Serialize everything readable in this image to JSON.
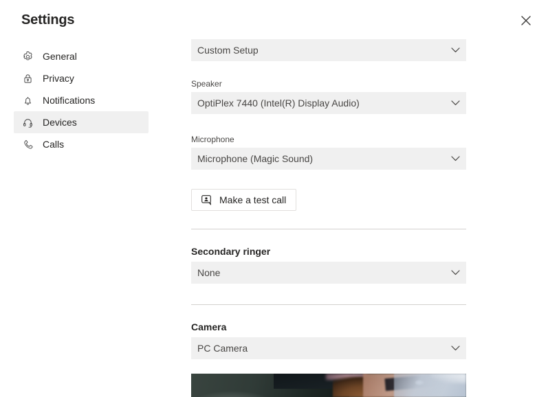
{
  "dialog": {
    "title": "Settings",
    "close_label": "Close"
  },
  "sidebar": {
    "items": [
      {
        "label": "General",
        "icon": "gear-icon",
        "selected": false
      },
      {
        "label": "Privacy",
        "icon": "lock-icon",
        "selected": false
      },
      {
        "label": "Notifications",
        "icon": "bell-icon",
        "selected": false
      },
      {
        "label": "Devices",
        "icon": "headset-icon",
        "selected": true
      },
      {
        "label": "Calls",
        "icon": "phone-icon",
        "selected": false
      }
    ]
  },
  "devices": {
    "audio_setup": {
      "value": "Custom Setup"
    },
    "speaker": {
      "label": "Speaker",
      "value": "OptiPlex 7440 (Intel(R) Display Audio)"
    },
    "microphone": {
      "label": "Microphone",
      "value": "Microphone (Magic Sound)"
    },
    "test_call": {
      "label": "Make a test call",
      "icon": "test-call-icon"
    },
    "secondary_ringer": {
      "heading": "Secondary ringer",
      "value": "None"
    },
    "camera": {
      "heading": "Camera",
      "value": "PC Camera",
      "preview_alt": "camera-preview"
    }
  },
  "colors": {
    "field_background": "#f0f0f0",
    "selected_nav_background": "#f0f0f0",
    "divider": "#d2d0ce",
    "text_primary": "#252423",
    "text_secondary": "#484644",
    "button_border": "#e1dfdd"
  }
}
